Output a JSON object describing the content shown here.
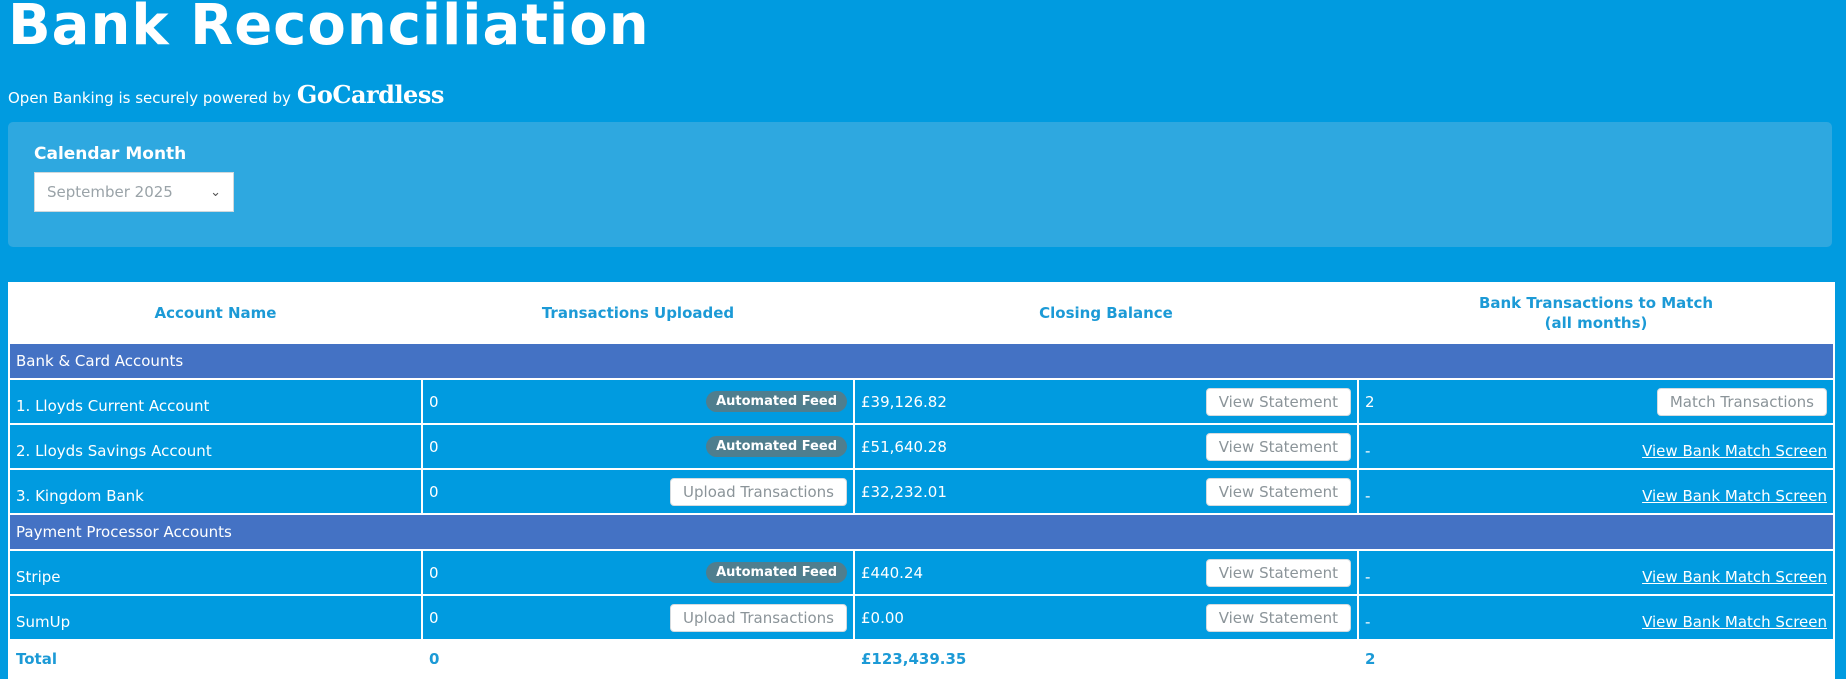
{
  "page": {
    "title": "Bank Reconciliation",
    "powered_text": "Open Banking is securely powered by",
    "powered_logo": "GoCardless"
  },
  "filter": {
    "label": "Calendar Month",
    "selected": "September 2025"
  },
  "table": {
    "headers": {
      "account_name": "Account Name",
      "transactions_uploaded": "Transactions Uploaded",
      "closing_balance": "Closing Balance",
      "to_match_line1": "Bank Transactions to Match",
      "to_match_line2": "(all months)"
    },
    "sections": [
      {
        "title": "Bank & Card Accounts",
        "rows": [
          {
            "name": "1. Lloyds Current Account",
            "uploaded": "0",
            "upload_action": "Automated Feed",
            "balance": "£39,126.82",
            "statement_btn": "View Statement",
            "to_match": "2",
            "match_action": "Match Transactions"
          },
          {
            "name": "2. Lloyds Savings Account",
            "uploaded": "0",
            "upload_action": "Automated Feed",
            "balance": "£51,640.28",
            "statement_btn": "View Statement",
            "to_match": "-",
            "match_action": "View Bank Match Screen"
          },
          {
            "name": "3. Kingdom Bank",
            "uploaded": "0",
            "upload_action": "Upload Transactions",
            "balance": "£32,232.01",
            "statement_btn": "View Statement",
            "to_match": "-",
            "match_action": "View Bank Match Screen"
          }
        ]
      },
      {
        "title": "Payment Processor Accounts",
        "rows": [
          {
            "name": "Stripe",
            "uploaded": "0",
            "upload_action": "Automated Feed",
            "balance": "£440.24",
            "statement_btn": "View Statement",
            "to_match": "-",
            "match_action": "View Bank Match Screen"
          },
          {
            "name": "SumUp",
            "uploaded": "0",
            "upload_action": "Upload Transactions",
            "balance": "£0.00",
            "statement_btn": "View Statement",
            "to_match": "-",
            "match_action": "View Bank Match Screen"
          }
        ]
      }
    ],
    "total": {
      "label": "Total",
      "uploaded": "0",
      "balance": "£123,439.35",
      "to_match": "2"
    }
  },
  "icons": {
    "select_chevron": "chevron-down-icon"
  },
  "colors": {
    "background": "#009be0",
    "section_header": "#4472c4",
    "badge": "#4f7e8e",
    "header_text": "#1c9ad6"
  }
}
